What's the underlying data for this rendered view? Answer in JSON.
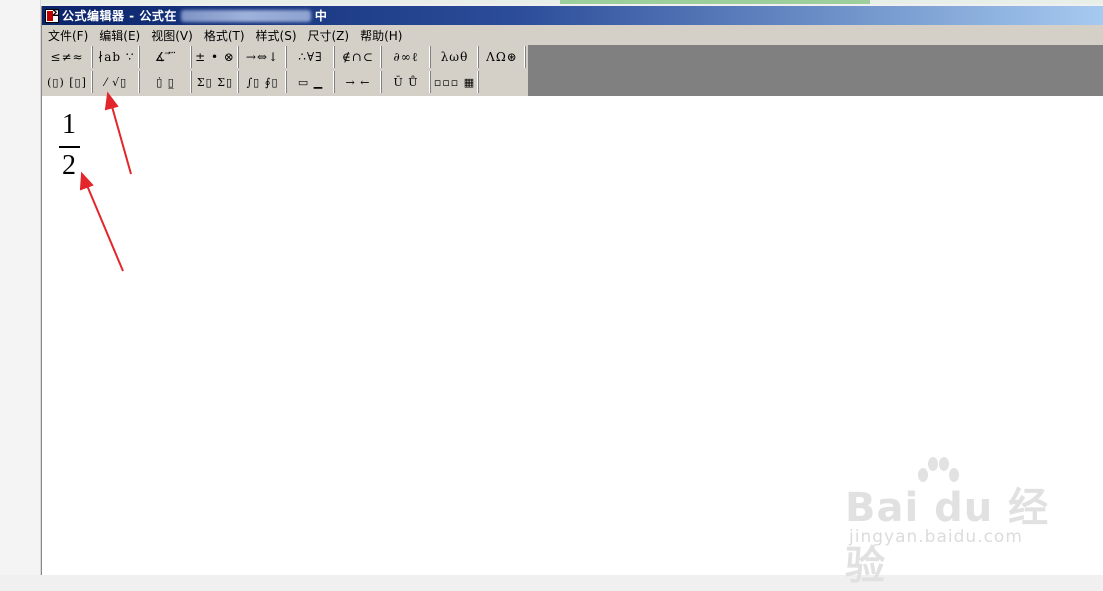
{
  "window": {
    "title_prefix": "公式编辑器 - 公式在",
    "title_suffix": "中"
  },
  "menu": [
    {
      "label": "文件(F)"
    },
    {
      "label": "编辑(E)"
    },
    {
      "label": "视图(V)"
    },
    {
      "label": "格式(T)"
    },
    {
      "label": "样式(S)"
    },
    {
      "label": "尺寸(Z)"
    },
    {
      "label": "帮助(H)"
    }
  ],
  "toolbar": {
    "row1": [
      {
        "label": "≤≠≈",
        "icon": "relational-symbols-icon"
      },
      {
        "label": "∤ab ∵",
        "icon": "spaces-ellipses-icon"
      },
      {
        "label": "∡ ⃗ ⃛",
        "icon": "embellishments-icon"
      },
      {
        "label": "± • ⊗",
        "icon": "operator-symbols-icon"
      },
      {
        "label": "→⇔↓",
        "icon": "arrow-symbols-icon"
      },
      {
        "label": "∴∀∃",
        "icon": "logical-symbols-icon"
      },
      {
        "label": "∉∩⊂",
        "icon": "set-theory-symbols-icon"
      },
      {
        "label": "∂∞ℓ",
        "icon": "misc-symbols-icon"
      },
      {
        "label": "λωθ",
        "icon": "greek-lowercase-icon"
      },
      {
        "label": "ΛΩ⊛",
        "icon": "greek-uppercase-icon"
      }
    ],
    "row2": [
      {
        "label": "(▯) [▯]",
        "icon": "fence-templates-icon"
      },
      {
        "label": "⁄ √▯",
        "icon": "fraction-radical-templates-icon"
      },
      {
        "label": "▯̇ ▯̲",
        "icon": "subscript-superscript-templates-icon"
      },
      {
        "label": "Σ▯ Σ▯",
        "icon": "summation-templates-icon"
      },
      {
        "label": "∫▯ ∮▯",
        "icon": "integral-templates-icon"
      },
      {
        "label": "▭ ▁",
        "icon": "underbar-overbar-templates-icon"
      },
      {
        "label": "→ ←",
        "icon": "labeled-arrow-templates-icon"
      },
      {
        "label": "Ū Ů",
        "icon": "products-set-theory-templates-icon"
      },
      {
        "label": "▫▫▫ ▦",
        "icon": "matrix-templates-icon"
      }
    ]
  },
  "equation": {
    "numerator": "1",
    "denominator": "2"
  },
  "watermark": {
    "main": "Bai du 经验",
    "sub": "jingyan.baidu.com"
  },
  "colors": {
    "titlebar_start": "#0a246a",
    "titlebar_end": "#a6caf0",
    "chrome": "#d4d0c8",
    "arrow": "#e3262b"
  }
}
